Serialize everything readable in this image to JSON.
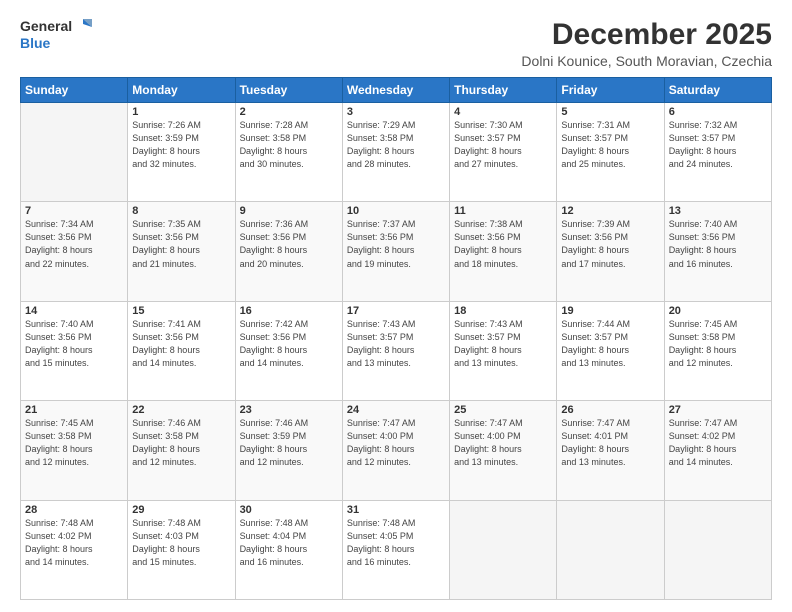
{
  "logo": {
    "line1": "General",
    "line2": "Blue"
  },
  "header": {
    "title": "December 2025",
    "subtitle": "Dolni Kounice, South Moravian, Czechia"
  },
  "days_of_week": [
    "Sunday",
    "Monday",
    "Tuesday",
    "Wednesday",
    "Thursday",
    "Friday",
    "Saturday"
  ],
  "weeks": [
    [
      {
        "day": "",
        "info": ""
      },
      {
        "day": "1",
        "info": "Sunrise: 7:26 AM\nSunset: 3:59 PM\nDaylight: 8 hours\nand 32 minutes."
      },
      {
        "day": "2",
        "info": "Sunrise: 7:28 AM\nSunset: 3:58 PM\nDaylight: 8 hours\nand 30 minutes."
      },
      {
        "day": "3",
        "info": "Sunrise: 7:29 AM\nSunset: 3:58 PM\nDaylight: 8 hours\nand 28 minutes."
      },
      {
        "day": "4",
        "info": "Sunrise: 7:30 AM\nSunset: 3:57 PM\nDaylight: 8 hours\nand 27 minutes."
      },
      {
        "day": "5",
        "info": "Sunrise: 7:31 AM\nSunset: 3:57 PM\nDaylight: 8 hours\nand 25 minutes."
      },
      {
        "day": "6",
        "info": "Sunrise: 7:32 AM\nSunset: 3:57 PM\nDaylight: 8 hours\nand 24 minutes."
      }
    ],
    [
      {
        "day": "7",
        "info": "Sunrise: 7:34 AM\nSunset: 3:56 PM\nDaylight: 8 hours\nand 22 minutes."
      },
      {
        "day": "8",
        "info": "Sunrise: 7:35 AM\nSunset: 3:56 PM\nDaylight: 8 hours\nand 21 minutes."
      },
      {
        "day": "9",
        "info": "Sunrise: 7:36 AM\nSunset: 3:56 PM\nDaylight: 8 hours\nand 20 minutes."
      },
      {
        "day": "10",
        "info": "Sunrise: 7:37 AM\nSunset: 3:56 PM\nDaylight: 8 hours\nand 19 minutes."
      },
      {
        "day": "11",
        "info": "Sunrise: 7:38 AM\nSunset: 3:56 PM\nDaylight: 8 hours\nand 18 minutes."
      },
      {
        "day": "12",
        "info": "Sunrise: 7:39 AM\nSunset: 3:56 PM\nDaylight: 8 hours\nand 17 minutes."
      },
      {
        "day": "13",
        "info": "Sunrise: 7:40 AM\nSunset: 3:56 PM\nDaylight: 8 hours\nand 16 minutes."
      }
    ],
    [
      {
        "day": "14",
        "info": "Sunrise: 7:40 AM\nSunset: 3:56 PM\nDaylight: 8 hours\nand 15 minutes."
      },
      {
        "day": "15",
        "info": "Sunrise: 7:41 AM\nSunset: 3:56 PM\nDaylight: 8 hours\nand 14 minutes."
      },
      {
        "day": "16",
        "info": "Sunrise: 7:42 AM\nSunset: 3:56 PM\nDaylight: 8 hours\nand 14 minutes."
      },
      {
        "day": "17",
        "info": "Sunrise: 7:43 AM\nSunset: 3:57 PM\nDaylight: 8 hours\nand 13 minutes."
      },
      {
        "day": "18",
        "info": "Sunrise: 7:43 AM\nSunset: 3:57 PM\nDaylight: 8 hours\nand 13 minutes."
      },
      {
        "day": "19",
        "info": "Sunrise: 7:44 AM\nSunset: 3:57 PM\nDaylight: 8 hours\nand 13 minutes."
      },
      {
        "day": "20",
        "info": "Sunrise: 7:45 AM\nSunset: 3:58 PM\nDaylight: 8 hours\nand 12 minutes."
      }
    ],
    [
      {
        "day": "21",
        "info": "Sunrise: 7:45 AM\nSunset: 3:58 PM\nDaylight: 8 hours\nand 12 minutes."
      },
      {
        "day": "22",
        "info": "Sunrise: 7:46 AM\nSunset: 3:58 PM\nDaylight: 8 hours\nand 12 minutes."
      },
      {
        "day": "23",
        "info": "Sunrise: 7:46 AM\nSunset: 3:59 PM\nDaylight: 8 hours\nand 12 minutes."
      },
      {
        "day": "24",
        "info": "Sunrise: 7:47 AM\nSunset: 4:00 PM\nDaylight: 8 hours\nand 12 minutes."
      },
      {
        "day": "25",
        "info": "Sunrise: 7:47 AM\nSunset: 4:00 PM\nDaylight: 8 hours\nand 13 minutes."
      },
      {
        "day": "26",
        "info": "Sunrise: 7:47 AM\nSunset: 4:01 PM\nDaylight: 8 hours\nand 13 minutes."
      },
      {
        "day": "27",
        "info": "Sunrise: 7:47 AM\nSunset: 4:02 PM\nDaylight: 8 hours\nand 14 minutes."
      }
    ],
    [
      {
        "day": "28",
        "info": "Sunrise: 7:48 AM\nSunset: 4:02 PM\nDaylight: 8 hours\nand 14 minutes."
      },
      {
        "day": "29",
        "info": "Sunrise: 7:48 AM\nSunset: 4:03 PM\nDaylight: 8 hours\nand 15 minutes."
      },
      {
        "day": "30",
        "info": "Sunrise: 7:48 AM\nSunset: 4:04 PM\nDaylight: 8 hours\nand 16 minutes."
      },
      {
        "day": "31",
        "info": "Sunrise: 7:48 AM\nSunset: 4:05 PM\nDaylight: 8 hours\nand 16 minutes."
      },
      {
        "day": "",
        "info": ""
      },
      {
        "day": "",
        "info": ""
      },
      {
        "day": "",
        "info": ""
      }
    ]
  ]
}
